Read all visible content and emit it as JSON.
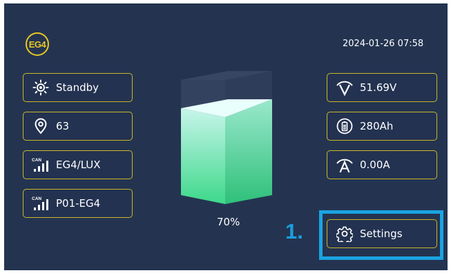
{
  "header": {
    "logo_text": "EG4",
    "datetime": "2024-01-26  07:58"
  },
  "left_cards": [
    {
      "label": "Standby",
      "icon": "sun-icon"
    },
    {
      "label": "63",
      "icon": "location-pin-icon"
    },
    {
      "label": "EG4/LUX",
      "icon": "can-signal-icon"
    },
    {
      "label": "P01-EG4",
      "icon": "can-signal-icon"
    }
  ],
  "right_cards": [
    {
      "label": "51.69V",
      "icon": "voltage-icon"
    },
    {
      "label": "280Ah",
      "icon": "battery-capacity-icon"
    },
    {
      "label": "0.00A",
      "icon": "current-icon"
    }
  ],
  "battery": {
    "percent_label": "70%",
    "level": 0.7,
    "fill_color": "#3dd88a"
  },
  "settings": {
    "label": "Settings",
    "step_label": "1."
  },
  "colors": {
    "background": "#243450",
    "card_border": "#c9b82a",
    "highlight": "#1ba3e2",
    "accent": "#e8c824"
  }
}
